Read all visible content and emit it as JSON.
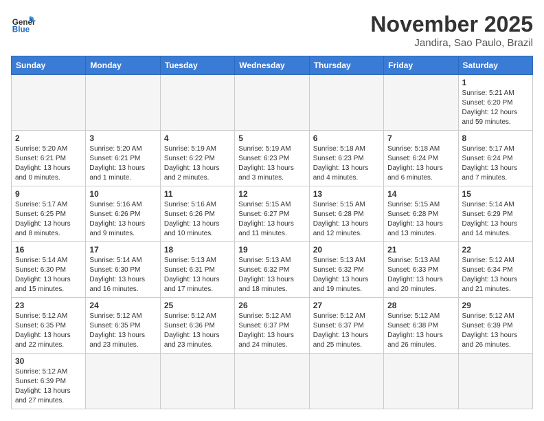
{
  "header": {
    "logo_general": "General",
    "logo_blue": "Blue",
    "month_title": "November 2025",
    "location": "Jandira, Sao Paulo, Brazil"
  },
  "weekdays": [
    "Sunday",
    "Monday",
    "Tuesday",
    "Wednesday",
    "Thursday",
    "Friday",
    "Saturday"
  ],
  "weeks": [
    [
      {
        "day": "",
        "info": ""
      },
      {
        "day": "",
        "info": ""
      },
      {
        "day": "",
        "info": ""
      },
      {
        "day": "",
        "info": ""
      },
      {
        "day": "",
        "info": ""
      },
      {
        "day": "",
        "info": ""
      },
      {
        "day": "1",
        "info": "Sunrise: 5:21 AM\nSunset: 6:20 PM\nDaylight: 12 hours\nand 59 minutes."
      }
    ],
    [
      {
        "day": "2",
        "info": "Sunrise: 5:20 AM\nSunset: 6:21 PM\nDaylight: 13 hours\nand 0 minutes."
      },
      {
        "day": "3",
        "info": "Sunrise: 5:20 AM\nSunset: 6:21 PM\nDaylight: 13 hours\nand 1 minute."
      },
      {
        "day": "4",
        "info": "Sunrise: 5:19 AM\nSunset: 6:22 PM\nDaylight: 13 hours\nand 2 minutes."
      },
      {
        "day": "5",
        "info": "Sunrise: 5:19 AM\nSunset: 6:23 PM\nDaylight: 13 hours\nand 3 minutes."
      },
      {
        "day": "6",
        "info": "Sunrise: 5:18 AM\nSunset: 6:23 PM\nDaylight: 13 hours\nand 4 minutes."
      },
      {
        "day": "7",
        "info": "Sunrise: 5:18 AM\nSunset: 6:24 PM\nDaylight: 13 hours\nand 6 minutes."
      },
      {
        "day": "8",
        "info": "Sunrise: 5:17 AM\nSunset: 6:24 PM\nDaylight: 13 hours\nand 7 minutes."
      }
    ],
    [
      {
        "day": "9",
        "info": "Sunrise: 5:17 AM\nSunset: 6:25 PM\nDaylight: 13 hours\nand 8 minutes."
      },
      {
        "day": "10",
        "info": "Sunrise: 5:16 AM\nSunset: 6:26 PM\nDaylight: 13 hours\nand 9 minutes."
      },
      {
        "day": "11",
        "info": "Sunrise: 5:16 AM\nSunset: 6:26 PM\nDaylight: 13 hours\nand 10 minutes."
      },
      {
        "day": "12",
        "info": "Sunrise: 5:15 AM\nSunset: 6:27 PM\nDaylight: 13 hours\nand 11 minutes."
      },
      {
        "day": "13",
        "info": "Sunrise: 5:15 AM\nSunset: 6:28 PM\nDaylight: 13 hours\nand 12 minutes."
      },
      {
        "day": "14",
        "info": "Sunrise: 5:15 AM\nSunset: 6:28 PM\nDaylight: 13 hours\nand 13 minutes."
      },
      {
        "day": "15",
        "info": "Sunrise: 5:14 AM\nSunset: 6:29 PM\nDaylight: 13 hours\nand 14 minutes."
      }
    ],
    [
      {
        "day": "16",
        "info": "Sunrise: 5:14 AM\nSunset: 6:30 PM\nDaylight: 13 hours\nand 15 minutes."
      },
      {
        "day": "17",
        "info": "Sunrise: 5:14 AM\nSunset: 6:30 PM\nDaylight: 13 hours\nand 16 minutes."
      },
      {
        "day": "18",
        "info": "Sunrise: 5:13 AM\nSunset: 6:31 PM\nDaylight: 13 hours\nand 17 minutes."
      },
      {
        "day": "19",
        "info": "Sunrise: 5:13 AM\nSunset: 6:32 PM\nDaylight: 13 hours\nand 18 minutes."
      },
      {
        "day": "20",
        "info": "Sunrise: 5:13 AM\nSunset: 6:32 PM\nDaylight: 13 hours\nand 19 minutes."
      },
      {
        "day": "21",
        "info": "Sunrise: 5:13 AM\nSunset: 6:33 PM\nDaylight: 13 hours\nand 20 minutes."
      },
      {
        "day": "22",
        "info": "Sunrise: 5:12 AM\nSunset: 6:34 PM\nDaylight: 13 hours\nand 21 minutes."
      }
    ],
    [
      {
        "day": "23",
        "info": "Sunrise: 5:12 AM\nSunset: 6:35 PM\nDaylight: 13 hours\nand 22 minutes."
      },
      {
        "day": "24",
        "info": "Sunrise: 5:12 AM\nSunset: 6:35 PM\nDaylight: 13 hours\nand 23 minutes."
      },
      {
        "day": "25",
        "info": "Sunrise: 5:12 AM\nSunset: 6:36 PM\nDaylight: 13 hours\nand 23 minutes."
      },
      {
        "day": "26",
        "info": "Sunrise: 5:12 AM\nSunset: 6:37 PM\nDaylight: 13 hours\nand 24 minutes."
      },
      {
        "day": "27",
        "info": "Sunrise: 5:12 AM\nSunset: 6:37 PM\nDaylight: 13 hours\nand 25 minutes."
      },
      {
        "day": "28",
        "info": "Sunrise: 5:12 AM\nSunset: 6:38 PM\nDaylight: 13 hours\nand 26 minutes."
      },
      {
        "day": "29",
        "info": "Sunrise: 5:12 AM\nSunset: 6:39 PM\nDaylight: 13 hours\nand 26 minutes."
      }
    ],
    [
      {
        "day": "30",
        "info": "Sunrise: 5:12 AM\nSunset: 6:39 PM\nDaylight: 13 hours\nand 27 minutes."
      },
      {
        "day": "",
        "info": ""
      },
      {
        "day": "",
        "info": ""
      },
      {
        "day": "",
        "info": ""
      },
      {
        "day": "",
        "info": ""
      },
      {
        "day": "",
        "info": ""
      },
      {
        "day": "",
        "info": ""
      }
    ]
  ]
}
